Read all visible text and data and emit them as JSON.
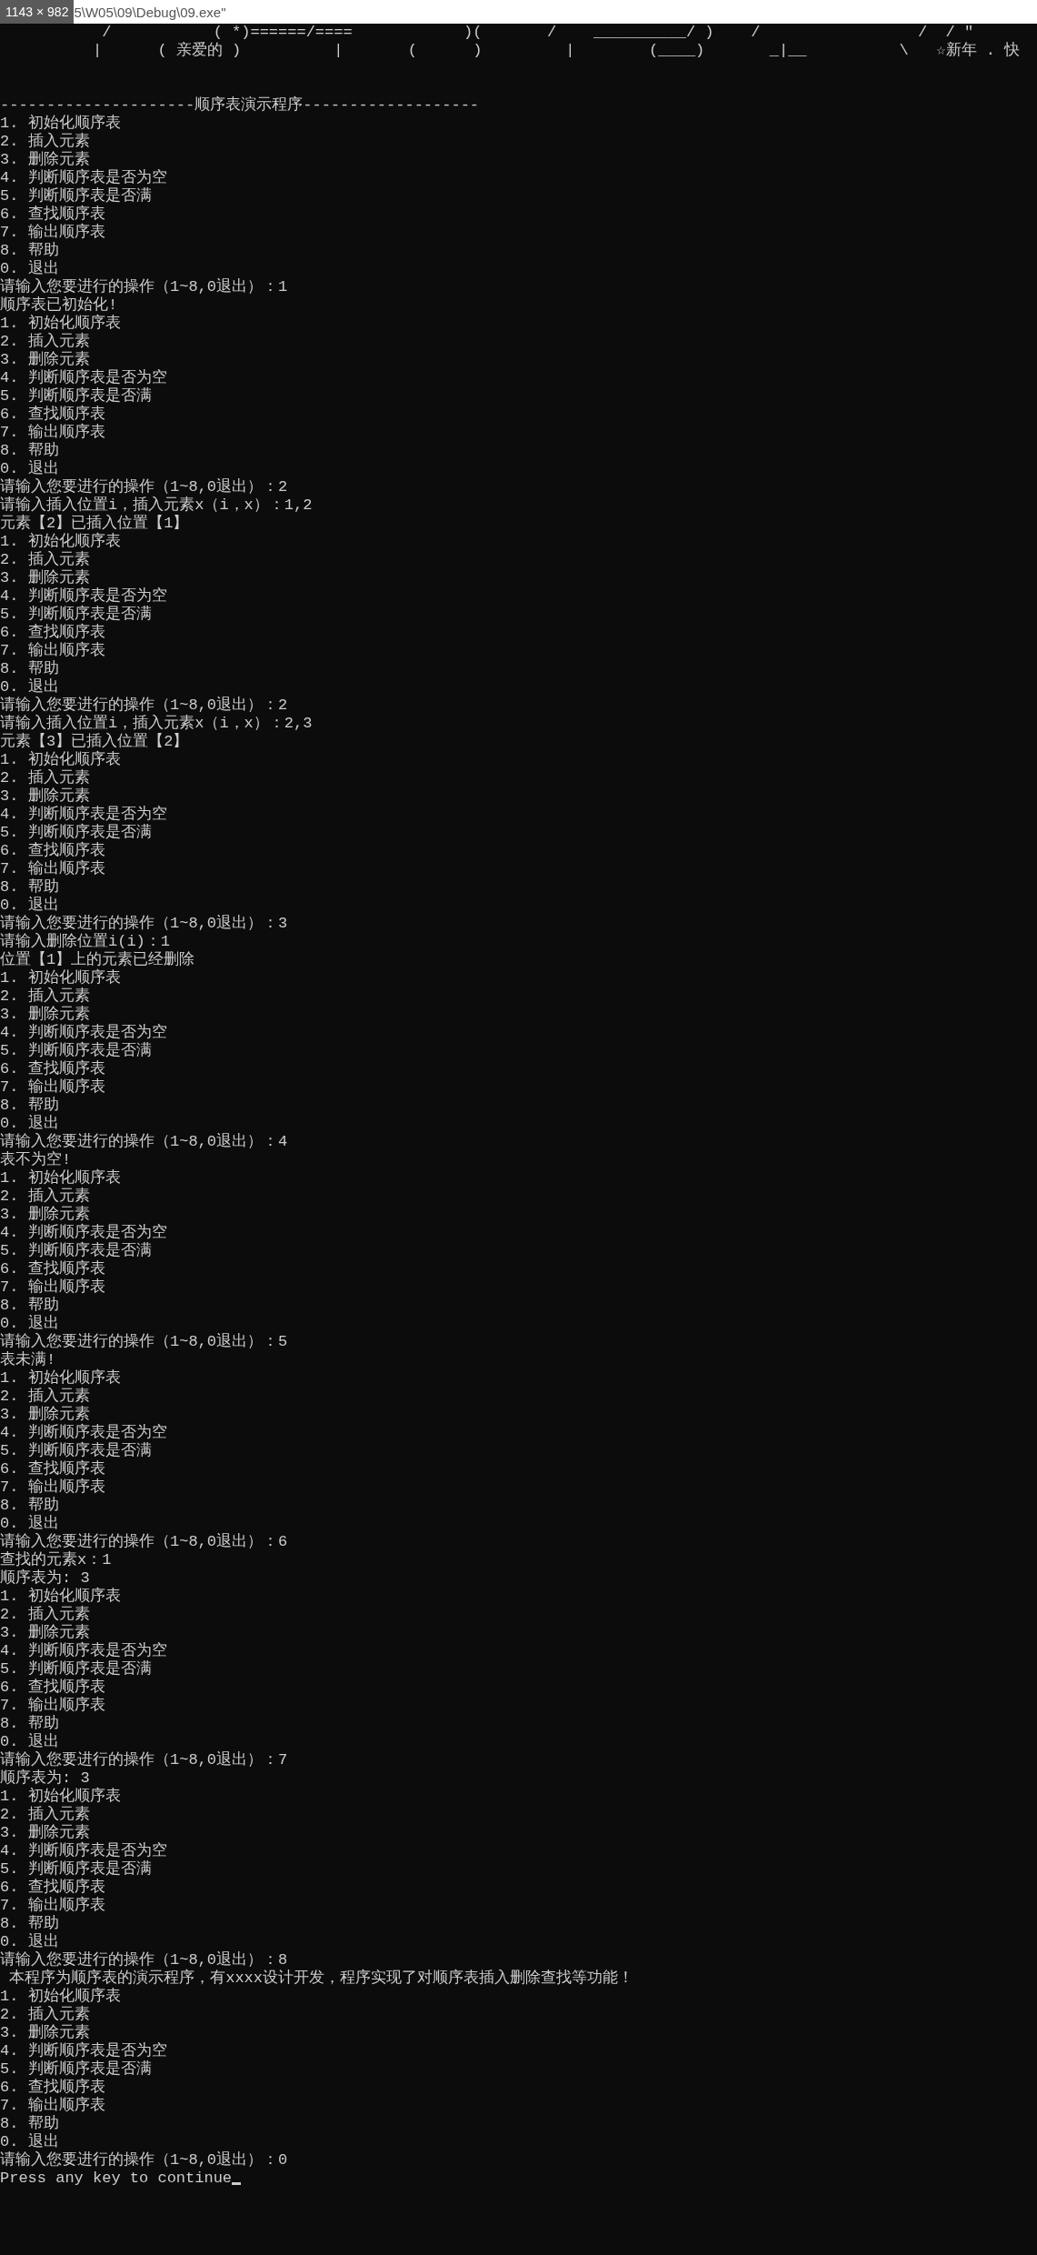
{
  "title_bar": {
    "size_badge": "1143 × 982",
    "title": "5\\W05\\09\\Debug\\09.exe\""
  },
  "console": {
    "art_lines": [
      "           /           ( *)======/====            )(       /    __________/ )    /                 /  / ″",
      "          |      ( 亲爱的 )          |       (      )         |        (____)       _|__          \\   ☆新年 . 快"
    ],
    "lines": [
      "---------------------顺序表演示程序-------------------",
      "1. 初始化顺序表",
      "2. 插入元素",
      "3. 删除元素",
      "4. 判断顺序表是否为空",
      "5. 判断顺序表是否满",
      "6. 查找顺序表",
      "7. 输出顺序表",
      "8. 帮助",
      "0. 退出",
      "请输入您要进行的操作（1~8,0退出）：1",
      "顺序表已初始化!",
      "1. 初始化顺序表",
      "2. 插入元素",
      "3. 删除元素",
      "4. 判断顺序表是否为空",
      "5. 判断顺序表是否满",
      "6. 查找顺序表",
      "7. 输出顺序表",
      "8. 帮助",
      "0. 退出",
      "请输入您要进行的操作（1~8,0退出）：2",
      "请输入插入位置i，插入元素x（i，x）：1,2",
      "元素【2】已插入位置【1】",
      "1. 初始化顺序表",
      "2. 插入元素",
      "3. 删除元素",
      "4. 判断顺序表是否为空",
      "5. 判断顺序表是否满",
      "6. 查找顺序表",
      "7. 输出顺序表",
      "8. 帮助",
      "0. 退出",
      "请输入您要进行的操作（1~8,0退出）：2",
      "请输入插入位置i，插入元素x（i，x）：2,3",
      "元素【3】已插入位置【2】",
      "1. 初始化顺序表",
      "2. 插入元素",
      "3. 删除元素",
      "4. 判断顺序表是否为空",
      "5. 判断顺序表是否满",
      "6. 查找顺序表",
      "7. 输出顺序表",
      "8. 帮助",
      "0. 退出",
      "请输入您要进行的操作（1~8,0退出）：3",
      "请输入删除位置i(i)：1",
      "位置【1】上的元素已经删除",
      "1. 初始化顺序表",
      "2. 插入元素",
      "3. 删除元素",
      "4. 判断顺序表是否为空",
      "5. 判断顺序表是否满",
      "6. 查找顺序表",
      "7. 输出顺序表",
      "8. 帮助",
      "0. 退出",
      "请输入您要进行的操作（1~8,0退出）：4",
      "表不为空!",
      "1. 初始化顺序表",
      "2. 插入元素",
      "3. 删除元素",
      "4. 判断顺序表是否为空",
      "5. 判断顺序表是否满",
      "6. 查找顺序表",
      "7. 输出顺序表",
      "8. 帮助",
      "0. 退出",
      "请输入您要进行的操作（1~8,0退出）：5",
      "表未满!",
      "1. 初始化顺序表",
      "2. 插入元素",
      "3. 删除元素",
      "4. 判断顺序表是否为空",
      "5. 判断顺序表是否满",
      "6. 查找顺序表",
      "7. 输出顺序表",
      "8. 帮助",
      "0. 退出",
      "请输入您要进行的操作（1~8,0退出）：6",
      "查找的元素x：1",
      "顺序表为: 3",
      "1. 初始化顺序表",
      "2. 插入元素",
      "3. 删除元素",
      "4. 判断顺序表是否为空",
      "5. 判断顺序表是否满",
      "6. 查找顺序表",
      "7. 输出顺序表",
      "8. 帮助",
      "0. 退出",
      "请输入您要进行的操作（1~8,0退出）：7",
      "顺序表为: 3",
      "1. 初始化顺序表",
      "2. 插入元素",
      "3. 删除元素",
      "4. 判断顺序表是否为空",
      "5. 判断顺序表是否满",
      "6. 查找顺序表",
      "7. 输出顺序表",
      "8. 帮助",
      "0. 退出",
      "请输入您要进行的操作（1~8,0退出）：8",
      " 本程序为顺序表的演示程序，有xxxx设计开发，程序实现了对顺序表插入删除查找等功能！",
      "1. 初始化顺序表",
      "2. 插入元素",
      "3. 删除元素",
      "4. 判断顺序表是否为空",
      "5. 判断顺序表是否满",
      "6. 查找顺序表",
      "7. 输出顺序表",
      "8. 帮助",
      "0. 退出",
      "请输入您要进行的操作（1~8,0退出）：0",
      "Press any key to continue"
    ],
    "cursor_visible": true
  }
}
